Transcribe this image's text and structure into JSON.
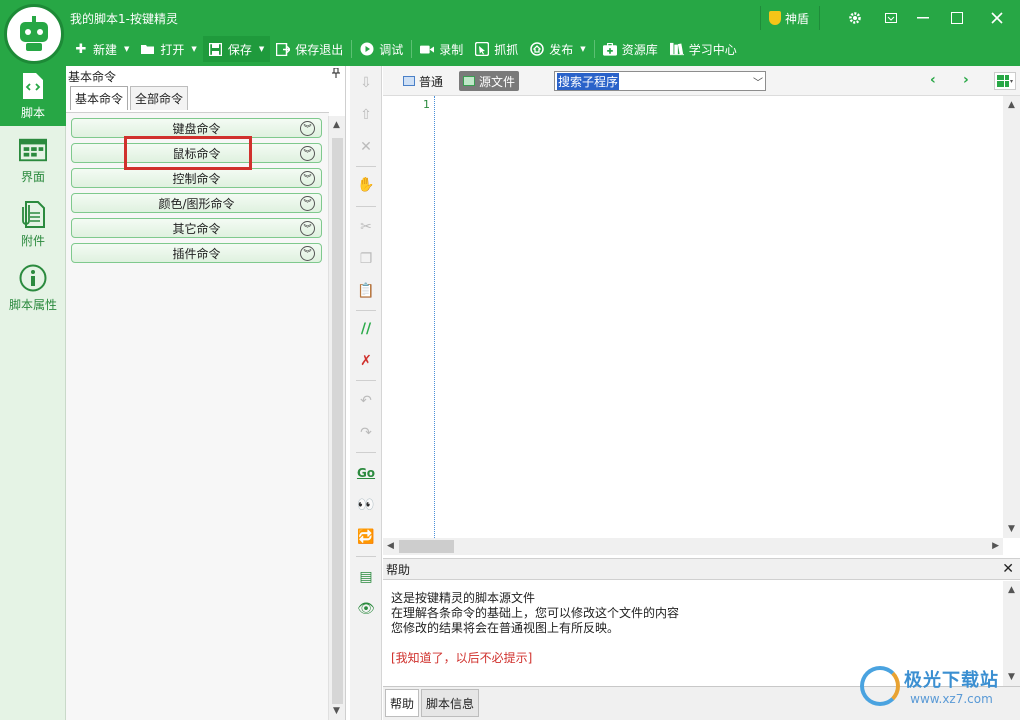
{
  "window": {
    "title": "我的脚本1-按键精灵",
    "shield_label": "神盾",
    "controls": [
      "gear-icon",
      "restore-icon",
      "minimize-icon",
      "maximize-icon",
      "close-icon"
    ]
  },
  "toolbar": {
    "items": [
      {
        "label": "新建",
        "icon": "plus-icon",
        "caret": true
      },
      {
        "label": "打开",
        "icon": "folder-icon",
        "caret": true
      },
      {
        "label": "保存",
        "icon": "save-icon",
        "caret": true
      },
      {
        "label": "保存退出",
        "icon": "save-exit-icon"
      },
      {
        "label": "调试",
        "icon": "play-icon"
      },
      {
        "label": "录制",
        "icon": "camera-icon"
      },
      {
        "label": "抓抓",
        "icon": "capture-icon"
      },
      {
        "label": "发布",
        "icon": "publish-icon",
        "caret": true
      },
      {
        "label": "资源库",
        "icon": "resource-icon"
      },
      {
        "label": "学习中心",
        "icon": "book-icon"
      }
    ]
  },
  "leftnav": {
    "items": [
      {
        "label": "脚本",
        "icon": "script-file-icon",
        "active": true
      },
      {
        "label": "界面",
        "icon": "interface-icon"
      },
      {
        "label": "附件",
        "icon": "attachment-icon"
      },
      {
        "label": "脚本属性",
        "icon": "info-icon"
      }
    ]
  },
  "command_panel": {
    "title": "基本命令",
    "tabs": [
      "基本命令",
      "全部命令"
    ],
    "commands": [
      "键盘命令",
      "鼠标命令",
      "控制命令",
      "颜色/图形命令",
      "其它命令",
      "插件命令"
    ],
    "highlighted": "鼠标命令"
  },
  "editor": {
    "modes": [
      {
        "label": "普通",
        "icon": "normal-view-icon"
      },
      {
        "label": "源文件",
        "icon": "source-file-icon",
        "active": true
      }
    ],
    "search_sub": "搜索子程序",
    "line_number": "1"
  },
  "help": {
    "title": "帮助",
    "lines": [
      "这是按键精灵的脚本源文件",
      "在理解各条命令的基础上，您可以修改这个文件的内容",
      "您修改的结果将会在普通视图上有所反映。"
    ],
    "dismiss": "[我知道了，以后不必提示]",
    "tabs": [
      "帮助",
      "脚本信息"
    ]
  },
  "watermark": {
    "name": "极光下载站",
    "url": "www.xz7.com"
  },
  "colors": {
    "brand_green": "#27a745",
    "highlight_red": "#d0312d"
  }
}
